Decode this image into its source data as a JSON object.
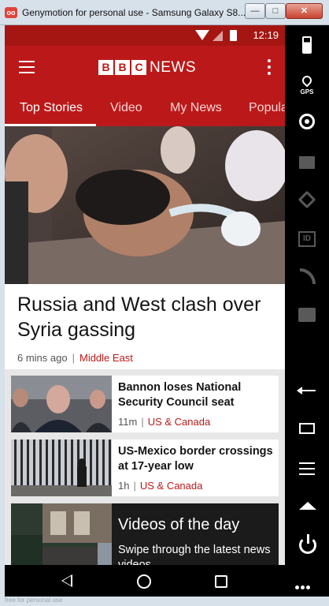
{
  "window": {
    "title": "Genymotion for personal use - Samsung Galaxy S8...",
    "icon_text": "oo",
    "footer_text": "free for personal use"
  },
  "status_bar": {
    "time": "12:19"
  },
  "app": {
    "logo_letters": [
      "B",
      "B",
      "C"
    ],
    "logo_word": "NEWS"
  },
  "tabs": [
    {
      "label": "Top Stories",
      "active": true
    },
    {
      "label": "Video",
      "active": false
    },
    {
      "label": "My News",
      "active": false
    },
    {
      "label": "Popular",
      "active": false
    }
  ],
  "hero": {
    "title": "Russia and West clash over Syria gassing",
    "time": "6 mins ago",
    "separator": "|",
    "category": "Middle East"
  },
  "stories": [
    {
      "title": "Bannon loses National Security Council seat",
      "time": "11m",
      "separator": "|",
      "category": "US & Canada"
    },
    {
      "title": "US-Mexico border crossings at 17-year low",
      "time": "1h",
      "separator": "|",
      "category": "US & Canada"
    }
  ],
  "video_card": {
    "title": "Videos of the day",
    "subtitle": "Swipe through the latest news videos"
  },
  "sidebar_labels": {
    "gps": "GPS",
    "id": "ID"
  },
  "colors": {
    "brand_red": "#bb1919",
    "status_red": "#a51612"
  }
}
